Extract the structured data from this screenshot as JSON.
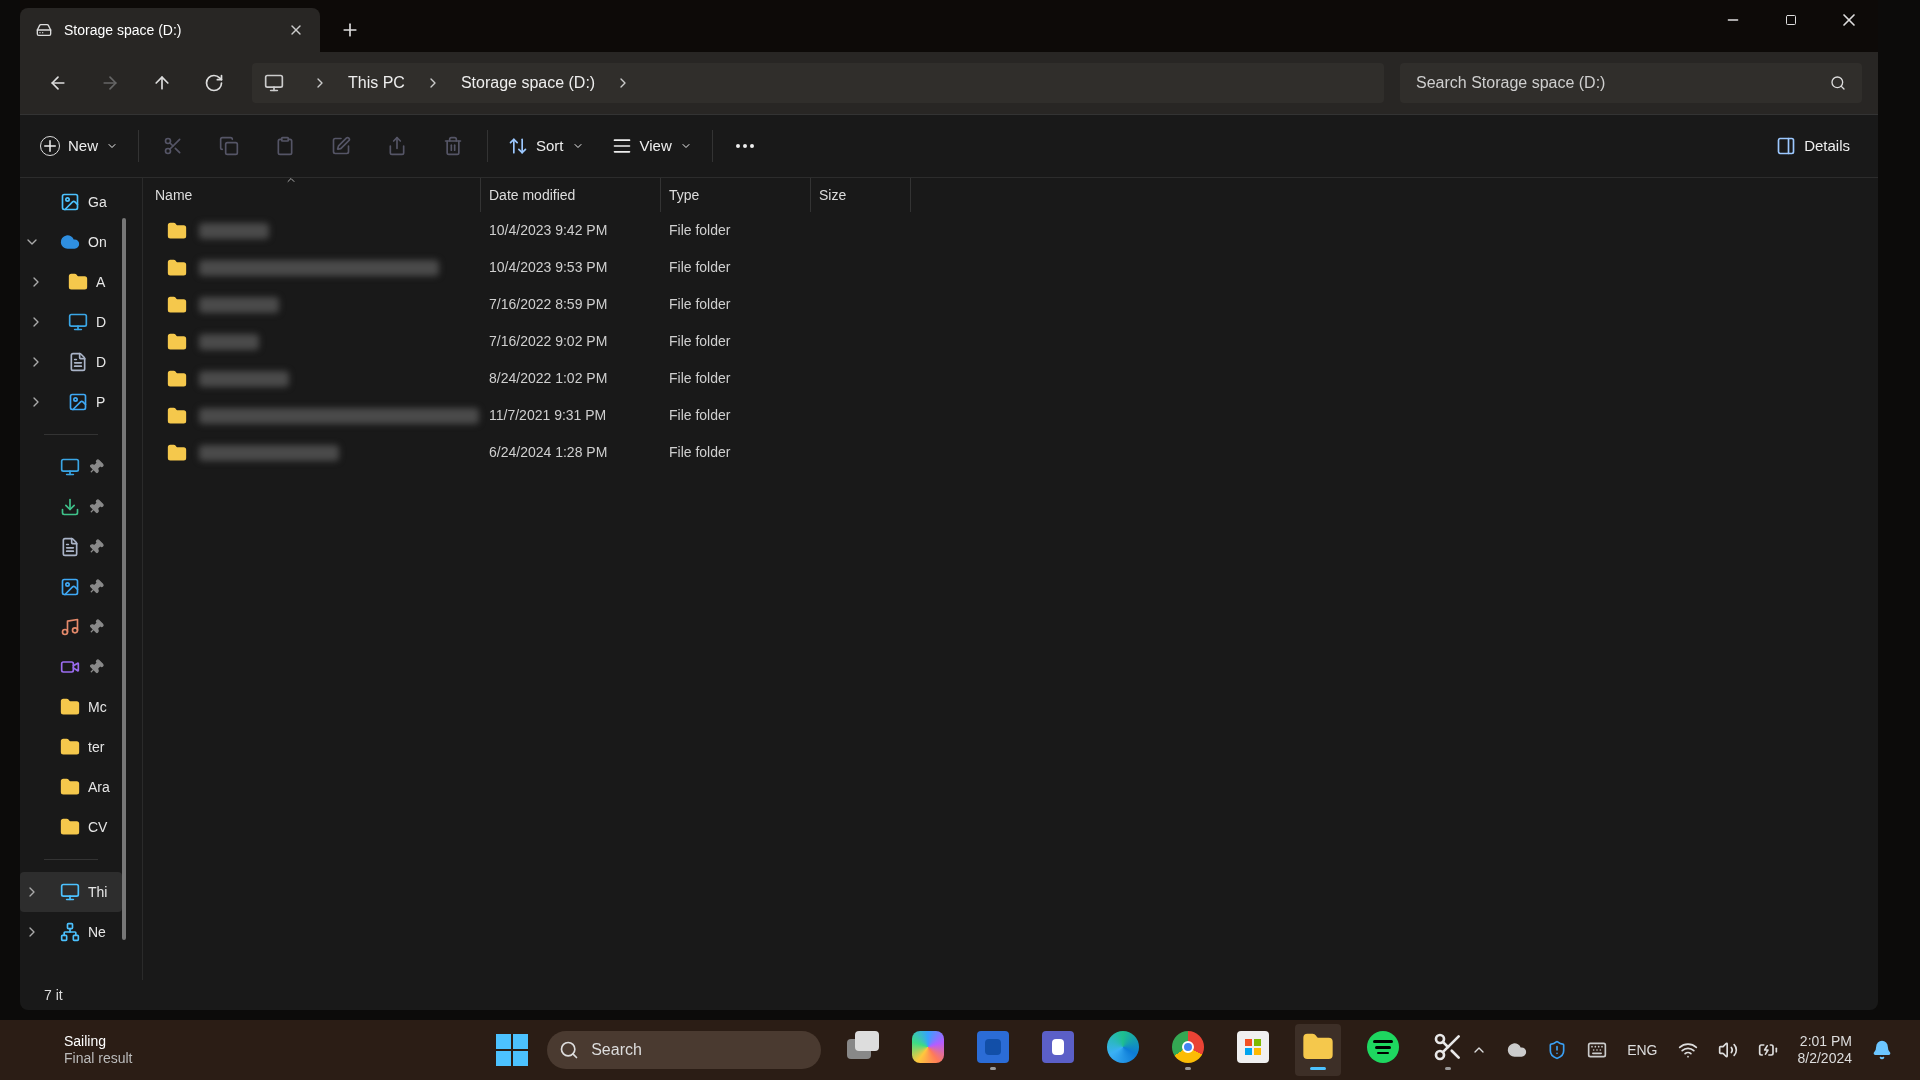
{
  "tab": {
    "title": "Storage space (D:)"
  },
  "breadcrumb": [
    "This PC",
    "Storage space (D:)"
  ],
  "search": {
    "placeholder": "Search Storage space (D:)"
  },
  "toolbar": {
    "new": "New",
    "sort": "Sort",
    "view": "View",
    "details": "Details"
  },
  "sidebar": {
    "items": [
      {
        "label": "Ga",
        "kind": "gallery",
        "selected": false
      },
      {
        "label": "On",
        "kind": "onedrive",
        "selected": false,
        "expanded": true,
        "children": [
          {
            "label": "A",
            "kind": "folder",
            "selected": false,
            "expanded": false
          },
          {
            "label": "D",
            "kind": "desktop",
            "selected": false,
            "expanded": false
          },
          {
            "label": "D",
            "kind": "document",
            "selected": false,
            "expanded": false
          },
          {
            "label": "P",
            "kind": "pictures",
            "selected": false,
            "expanded": false
          }
        ]
      },
      {
        "kind": "divider"
      },
      {
        "kind": "desktop",
        "selected": false,
        "pinned": true
      },
      {
        "kind": "download",
        "selected": false,
        "pinned": true
      },
      {
        "kind": "document",
        "selected": false,
        "pinned": true
      },
      {
        "kind": "pictures",
        "selected": false,
        "pinned": true
      },
      {
        "kind": "music",
        "selected": false,
        "pinned": true
      },
      {
        "kind": "video",
        "selected": false,
        "pinned": true
      },
      {
        "label": "Mc",
        "kind": "folder",
        "selected": false
      },
      {
        "label": "ter",
        "kind": "folder",
        "selected": false
      },
      {
        "label": "Ara",
        "kind": "folder",
        "selected": false
      },
      {
        "label": "CV",
        "kind": "folder",
        "selected": false
      },
      {
        "kind": "divider"
      },
      {
        "label": "Thi",
        "kind": "pc",
        "selected": true,
        "expanded": false
      },
      {
        "label": "Ne",
        "kind": "network",
        "selected": false,
        "expanded": false
      }
    ]
  },
  "table": {
    "columns": [
      {
        "label": "Name",
        "sorted": true
      },
      {
        "label": "Date modified",
        "sorted": false
      },
      {
        "label": "Type",
        "sorted": false
      },
      {
        "label": "Size",
        "sorted": false
      }
    ],
    "rows": [
      {
        "date": "10/4/2023 9:42 PM",
        "type": "File folder"
      },
      {
        "date": "10/4/2023 9:53 PM",
        "type": "File folder"
      },
      {
        "date": "7/16/2022 8:59 PM",
        "type": "File folder"
      },
      {
        "date": "7/16/2022 9:02 PM",
        "type": "File folder"
      },
      {
        "date": "8/24/2022 1:02 PM",
        "type": "File folder"
      },
      {
        "date": "11/7/2021 9:31 PM",
        "type": "File folder"
      },
      {
        "date": "6/24/2024 1:28 PM",
        "type": "File folder"
      }
    ]
  },
  "status_bar": {
    "items": "7 it"
  },
  "taskbar": {
    "weather": {
      "title": "Sailing",
      "subtitle": "Final result"
    },
    "search": "Search",
    "apps": [
      {
        "kind": "taskview",
        "running": false,
        "active": false
      },
      {
        "kind": "copilot",
        "running": false,
        "active": false
      },
      {
        "kind": "word",
        "running": true,
        "active": false
      },
      {
        "kind": "teams",
        "running": false,
        "active": false
      },
      {
        "kind": "edge",
        "running": false,
        "active": false
      },
      {
        "kind": "chrome",
        "running": true,
        "active": false
      },
      {
        "kind": "store",
        "running": false,
        "active": false
      },
      {
        "kind": "explorer",
        "running": true,
        "active": true
      },
      {
        "kind": "spotify",
        "running": false,
        "active": false
      },
      {
        "kind": "snipping",
        "running": true,
        "active": false
      }
    ],
    "language": "ENG",
    "time": "2:01 PM",
    "date": "8/2/2024"
  }
}
